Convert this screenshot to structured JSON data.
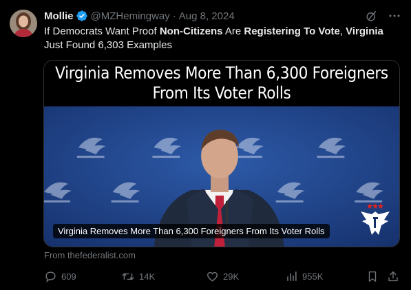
{
  "author": {
    "name": "Mollie",
    "handle": "@MZHemingway",
    "separator": "·",
    "date": "Aug 8, 2024"
  },
  "tweet": {
    "seg1": "If Democrats Want Proof ",
    "seg2": "Non-Citizens",
    "seg3": " Are ",
    "seg4": "Registering To Vote",
    "seg5": ", ",
    "seg6": "Virginia",
    "seg7": " Just Found 6,303 Examples"
  },
  "card": {
    "headline_line1": "Virginia Removes More Than 6,300 Foreigners",
    "headline_line2": "From Its Voter Rolls",
    "caption": "Virginia Removes More Than 6,300 Foreigners From Its Voter Rolls",
    "source": "From thefederalist.com"
  },
  "actions": {
    "replies": "609",
    "reposts": "14K",
    "likes": "29K",
    "views": "955K"
  },
  "icons": {
    "verified": "verified-badge-icon",
    "grok": "grok-icon",
    "more": "more-options-icon",
    "reply": "reply-icon",
    "repost": "repost-icon",
    "like": "like-icon",
    "views": "views-icon",
    "bookmark": "bookmark-icon",
    "share": "share-icon"
  },
  "colors": {
    "background": "#000000",
    "text": "#e7e9ea",
    "secondary": "#71767b",
    "verified": "#1d9bf0",
    "backdrop": "#1d3f8a"
  }
}
